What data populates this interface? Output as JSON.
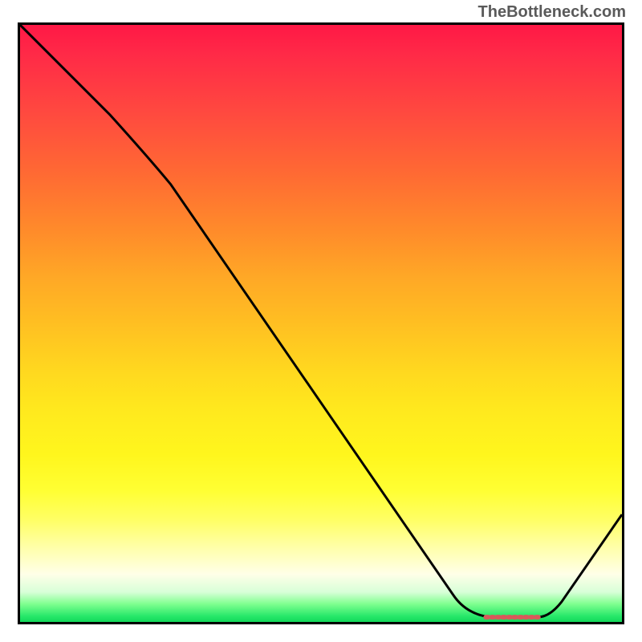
{
  "watermark": "TheBottleneck.com",
  "chart_data": {
    "type": "line",
    "title": "",
    "xlabel": "",
    "ylabel": "",
    "xlim": [
      0,
      100
    ],
    "ylim": [
      0,
      100
    ],
    "series": [
      {
        "name": "curve",
        "x": [
          0,
          15,
          25,
          72,
          78,
          86,
          100
        ],
        "values": [
          100,
          85,
          77,
          4.5,
          0.8,
          0.8,
          18
        ]
      }
    ],
    "marker_segment": {
      "x_start": 78,
      "x_end": 86,
      "y": 0.8,
      "color": "#d85a5a"
    },
    "gradient_stops": [
      {
        "pos": 0,
        "color": "#ff1846"
      },
      {
        "pos": 50,
        "color": "#ffbf22"
      },
      {
        "pos": 92,
        "color": "#ffffe8"
      },
      {
        "pos": 100,
        "color": "#12d85a"
      }
    ],
    "grid": false,
    "legend": "none"
  }
}
